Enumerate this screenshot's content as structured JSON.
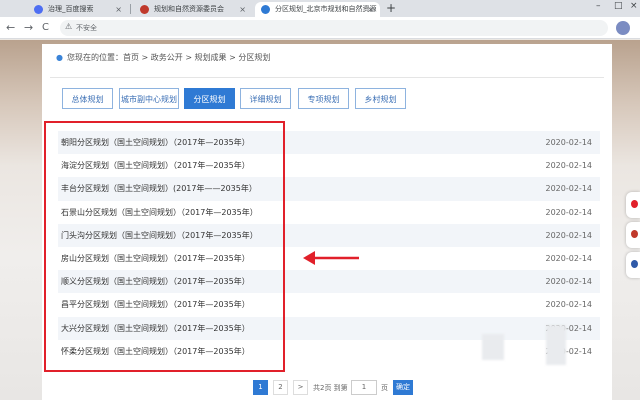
{
  "browser": {
    "tabs": [
      {
        "label": "治理_百度搜索",
        "fav_color": "#4e6ef2"
      },
      {
        "label": "规划和自然资源委员会",
        "fav_color": "#c0392b"
      },
      {
        "label": "分区规划_北京市规划和自然资源",
        "fav_color": "#2f7ad4"
      }
    ],
    "new_tab": "+",
    "address_insecure": "不安全",
    "back": "←",
    "forward": "→",
    "reload": "C",
    "warn_icon": "⚠"
  },
  "breadcrumb": {
    "text": "您现在的位置：首页 > 政务公开 > 规划成果 > 分区规划"
  },
  "category_tabs": [
    {
      "label": "总体规划",
      "active": false
    },
    {
      "label": "城市副中心规划",
      "active": false
    },
    {
      "label": "分区规划",
      "active": true
    },
    {
      "label": "详细规划",
      "active": false
    },
    {
      "label": "专项规划",
      "active": false
    },
    {
      "label": "乡村规划",
      "active": false
    }
  ],
  "list": [
    {
      "title": "朝阳分区规划（国土空间规划）（2017年—2035年）",
      "date": "2020-02-14"
    },
    {
      "title": "海淀分区规划（国土空间规划）（2017年—2035年）",
      "date": "2020-02-14"
    },
    {
      "title": "丰台分区规划（国土空间规划）(2017年——2035年）",
      "date": "2020-02-14"
    },
    {
      "title": "石景山分区规划（国土空间规划）（2017年—2035年）",
      "date": "2020-02-14"
    },
    {
      "title": "门头沟分区规划（国土空间规划）（2017年—2035年）",
      "date": "2020-02-14"
    },
    {
      "title": "房山分区规划（国土空间规划）（2017年—2035年）",
      "date": "2020-02-14"
    },
    {
      "title": "顺义分区规划（国土空间规划）（2017年—2035年）",
      "date": "2020-02-14"
    },
    {
      "title": "昌平分区规划（国土空间规划）（2017年—2035年）",
      "date": "2020-02-14"
    },
    {
      "title": "大兴分区规划（国土空间规划）（2017年—2035年）",
      "date": "2020-02-14"
    },
    {
      "title": "怀柔分区规划（国土空间规划）（2017年—2035年）",
      "date": "2020-02-14"
    }
  ],
  "pagination": {
    "pages": [
      "1",
      "2"
    ],
    "next": ">",
    "total": "共2页 到第",
    "page_input": "1",
    "page_unit": "页",
    "go": "确定"
  },
  "colors": {
    "accent": "#2f7ad4",
    "highlight": "#e1202a"
  }
}
